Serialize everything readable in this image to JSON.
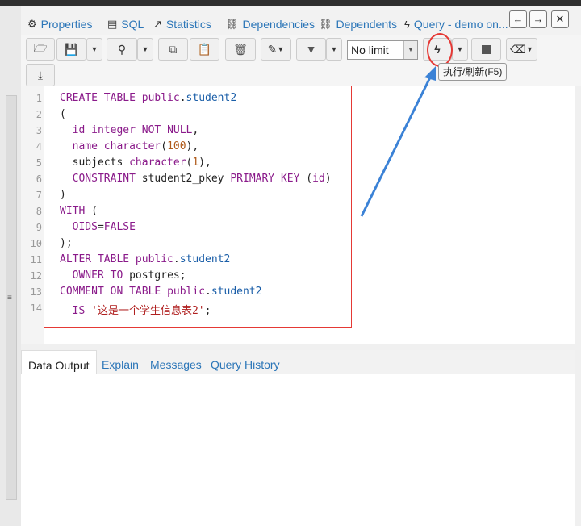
{
  "tabs": [
    {
      "icon": "properties-icon",
      "glyph": "⚙",
      "label": "Properties"
    },
    {
      "icon": "sql-icon",
      "glyph": "▤",
      "label": "SQL"
    },
    {
      "icon": "statistics-icon",
      "glyph": "📈",
      "label": "Statistics"
    },
    {
      "icon": "dependencies-icon",
      "glyph": "⛓",
      "label": "Dependencies"
    },
    {
      "icon": "dependents-icon",
      "glyph": "⛓",
      "label": "Dependents"
    },
    {
      "icon": "query-icon",
      "glyph": "ϟ",
      "label": "Query - demo on..."
    }
  ],
  "toolbar": {
    "limit": "No limit",
    "tooltip": "执行/刷新(F5)"
  },
  "editor": {
    "line_numbers": [
      "1",
      "2",
      "3",
      "4",
      "5",
      "6",
      "7",
      "8",
      "9",
      "10",
      "11",
      "12",
      "13",
      "14"
    ]
  },
  "result_tabs": [
    "Data Output",
    "Explain",
    "Messages",
    "Query History"
  ],
  "accent": "#e53935",
  "link_color": "#2c76b8"
}
